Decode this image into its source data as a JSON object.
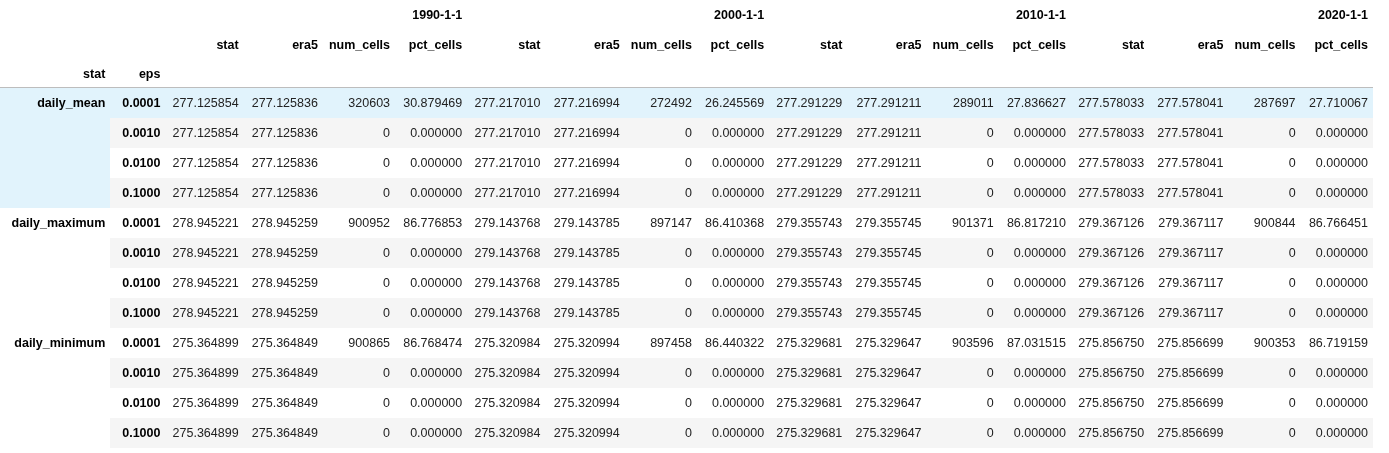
{
  "table": {
    "column_groups": [
      "1990-1-1",
      "2000-1-1",
      "2010-1-1",
      "2020-1-1"
    ],
    "columns": [
      "stat",
      "era5",
      "num_cells",
      "pct_cells",
      "stat",
      "era5",
      "num_cells",
      "pct_cells",
      "stat",
      "era5",
      "num_cells",
      "pct_cells",
      "stat",
      "era5",
      "num_cells",
      "pct_cells"
    ],
    "index_names": [
      "stat",
      "eps"
    ],
    "groups": [
      {
        "label": "daily_mean",
        "rows": [
          {
            "eps": "0.0001",
            "selected": true,
            "cells": [
              "277.125854",
              "277.125836",
              "320603",
              "30.879469",
              "277.217010",
              "277.216994",
              "272492",
              "26.245569",
              "277.291229",
              "277.291211",
              "289011",
              "27.836627",
              "277.578033",
              "277.578041",
              "287697",
              "27.710067"
            ]
          },
          {
            "eps": "0.0010",
            "selected": false,
            "cells": [
              "277.125854",
              "277.125836",
              "0",
              "0.000000",
              "277.217010",
              "277.216994",
              "0",
              "0.000000",
              "277.291229",
              "277.291211",
              "0",
              "0.000000",
              "277.578033",
              "277.578041",
              "0",
              "0.000000"
            ]
          },
          {
            "eps": "0.0100",
            "selected": false,
            "cells": [
              "277.125854",
              "277.125836",
              "0",
              "0.000000",
              "277.217010",
              "277.216994",
              "0",
              "0.000000",
              "277.291229",
              "277.291211",
              "0",
              "0.000000",
              "277.578033",
              "277.578041",
              "0",
              "0.000000"
            ]
          },
          {
            "eps": "0.1000",
            "selected": false,
            "cells": [
              "277.125854",
              "277.125836",
              "0",
              "0.000000",
              "277.217010",
              "277.216994",
              "0",
              "0.000000",
              "277.291229",
              "277.291211",
              "0",
              "0.000000",
              "277.578033",
              "277.578041",
              "0",
              "0.000000"
            ]
          }
        ]
      },
      {
        "label": "daily_maximum",
        "rows": [
          {
            "eps": "0.0001",
            "selected": false,
            "cells": [
              "278.945221",
              "278.945259",
              "900952",
              "86.776853",
              "279.143768",
              "279.143785",
              "897147",
              "86.410368",
              "279.355743",
              "279.355745",
              "901371",
              "86.817210",
              "279.367126",
              "279.367117",
              "900844",
              "86.766451"
            ]
          },
          {
            "eps": "0.0010",
            "selected": false,
            "cells": [
              "278.945221",
              "278.945259",
              "0",
              "0.000000",
              "279.143768",
              "279.143785",
              "0",
              "0.000000",
              "279.355743",
              "279.355745",
              "0",
              "0.000000",
              "279.367126",
              "279.367117",
              "0",
              "0.000000"
            ]
          },
          {
            "eps": "0.0100",
            "selected": false,
            "cells": [
              "278.945221",
              "278.945259",
              "0",
              "0.000000",
              "279.143768",
              "279.143785",
              "0",
              "0.000000",
              "279.355743",
              "279.355745",
              "0",
              "0.000000",
              "279.367126",
              "279.367117",
              "0",
              "0.000000"
            ]
          },
          {
            "eps": "0.1000",
            "selected": false,
            "cells": [
              "278.945221",
              "278.945259",
              "0",
              "0.000000",
              "279.143768",
              "279.143785",
              "0",
              "0.000000",
              "279.355743",
              "279.355745",
              "0",
              "0.000000",
              "279.367126",
              "279.367117",
              "0",
              "0.000000"
            ]
          }
        ]
      },
      {
        "label": "daily_minimum",
        "rows": [
          {
            "eps": "0.0001",
            "selected": false,
            "cells": [
              "275.364899",
              "275.364849",
              "900865",
              "86.768474",
              "275.320984",
              "275.320994",
              "897458",
              "86.440322",
              "275.329681",
              "275.329647",
              "903596",
              "87.031515",
              "275.856750",
              "275.856699",
              "900353",
              "86.719159"
            ]
          },
          {
            "eps": "0.0010",
            "selected": false,
            "cells": [
              "275.364899",
              "275.364849",
              "0",
              "0.000000",
              "275.320984",
              "275.320994",
              "0",
              "0.000000",
              "275.329681",
              "275.329647",
              "0",
              "0.000000",
              "275.856750",
              "275.856699",
              "0",
              "0.000000"
            ]
          },
          {
            "eps": "0.0100",
            "selected": false,
            "cells": [
              "275.364899",
              "275.364849",
              "0",
              "0.000000",
              "275.320984",
              "275.320994",
              "0",
              "0.000000",
              "275.329681",
              "275.329647",
              "0",
              "0.000000",
              "275.856750",
              "275.856699",
              "0",
              "0.000000"
            ]
          },
          {
            "eps": "0.1000",
            "selected": false,
            "cells": [
              "275.364899",
              "275.364849",
              "0",
              "0.000000",
              "275.320984",
              "275.320994",
              "0",
              "0.000000",
              "275.329681",
              "275.329647",
              "0",
              "0.000000",
              "275.856750",
              "275.856699",
              "0",
              "0.000000"
            ]
          }
        ]
      }
    ]
  }
}
